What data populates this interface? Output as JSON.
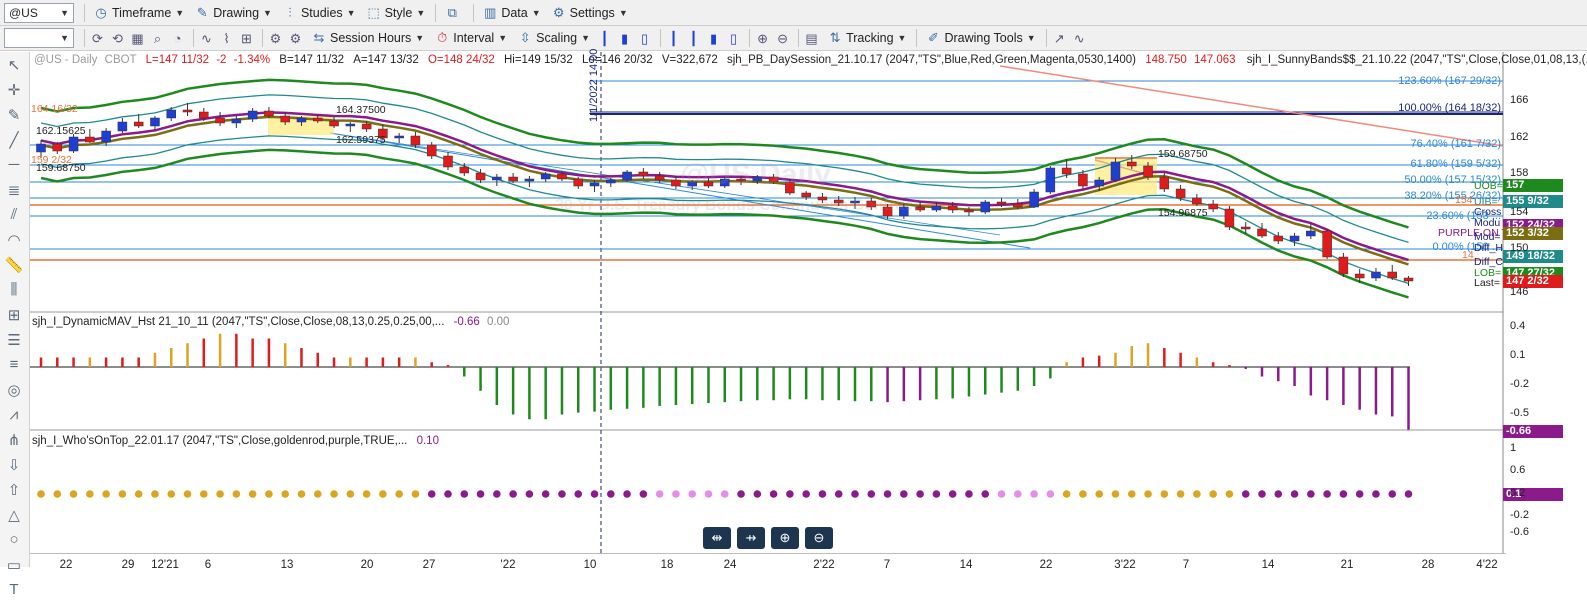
{
  "toolbar1": {
    "symbol": "@US",
    "timeframe": "Timeframe",
    "drawing": "Drawing",
    "studies": "Studies",
    "style": "Style",
    "data": "Data",
    "settings": "Settings"
  },
  "toolbar2": {
    "session_hours": "Session Hours",
    "interval": "Interval",
    "scaling": "Scaling",
    "tracking": "Tracking",
    "drawing_tools": "Drawing Tools"
  },
  "chart_header": {
    "symbol": "@US - Daily",
    "exchange": "CBOT",
    "last": "L=147 11/32",
    "chg": "-2",
    "chg_pct": "-1.34%",
    "bid": "B=147 11/32",
    "ask": "A=147 13/32",
    "open": "O=148 24/32",
    "high": "Hi=149 15/32",
    "low": "Lo=146 20/32",
    "volume": "V=322,672",
    "study1": "sjh_PB_DaySession_21.10.17 (2047,\"TS\",Blue,Red,Green,Magenta,0530,1400)",
    "study1_v1": "148.750",
    "study1_v2": "147.063",
    "study2": "sjh_I_SunnyBands$$_21.10.22 (2047,\"TS\",Close,Close,01,08,13,(..."
  },
  "watermark": {
    "title": "@US Daily",
    "subtitle": "30 Yr U.S. Treasury Bonds Continuous Contract"
  },
  "vline_label": "1/1/2022 14:00",
  "price_labels": {
    "a1": "164.37500",
    "a2": "162.59375",
    "a3": "162.15625",
    "a4": "159.68750",
    "a5": "164 16/32",
    "a6": "159 2/32",
    "b1": "159.68750",
    "b2": "154.96875",
    "purple": "PURPLE ON TOP"
  },
  "fib_levels": [
    {
      "label": "123.60% (167 29/32)"
    },
    {
      "label": "100.00% (164 18/32)"
    },
    {
      "label": "76.40% (161 7/32)"
    },
    {
      "label": "61.80% (159 5/32)"
    },
    {
      "label": "50.00% (157 15/32)"
    },
    {
      "label": "38.20% (155 26/32)"
    },
    {
      "label": "23.60% (153 ..."
    },
    {
      "label": "0.00% (150 ..."
    }
  ],
  "right_tags": {
    "uob": "UOB=",
    "uib": "UIB=",
    "cross": "Cross",
    "modu": "Modu",
    "modl": "Mod=",
    "diffh": "Diff_H",
    "diffc": "Diff_C",
    "lob": "LOB=",
    "last": "Last=",
    "t154": "154",
    "t14": "14"
  },
  "price_axis": [
    "166",
    "162",
    "158",
    "154",
    "150",
    "146"
  ],
  "price_boxes": [
    {
      "text": "157",
      "color": "#1e8a1e"
    },
    {
      "text": "155 9/32",
      "color": "#1f8a8a"
    },
    {
      "text": "152 24/32",
      "color": "#8b1a8b"
    },
    {
      "text": "152 3/32",
      "color": "#7a6e10"
    },
    {
      "text": "149 18/32",
      "color": "#1f8a8a"
    },
    {
      "text": "147 27/32",
      "color": "#1e8a1e"
    },
    {
      "text": "147 2/32",
      "color": "#e01b1b"
    }
  ],
  "panel2": {
    "title": "sjh_I_DynamicMAV_Hst 21_10_11 (2047,\"TS\",Close,Close,08,13,0.25,0.25,00,...",
    "v1": "-0.66",
    "v2": "0.00",
    "axis": [
      "0.4",
      "0.1",
      "-0.2",
      "-0.5"
    ],
    "box": "-0.66"
  },
  "panel3": {
    "title": "sjh_I_Who'sOnTop_22.01.17 (2047,\"TS\",Close,goldenrod,purple,TRUE,...",
    "v1": "0.10",
    "axis": [
      "1",
      "0.6",
      "0.2",
      "-0.2",
      "-0.6"
    ],
    "box": "0.1"
  },
  "x_axis": [
    "22",
    "29",
    "12'21",
    "6",
    "13",
    "20",
    "27",
    "'22",
    "10",
    "18",
    "24",
    "2'22",
    "7",
    "14",
    "22",
    "3'22",
    "7",
    "14",
    "21",
    "28",
    "4'22"
  ],
  "left_tools": [
    "cursor-icon",
    "crosshair-icon",
    "pencil-icon",
    "trendline-icon",
    "horizontal-line-icon",
    "fibonacci-icon",
    "channel-icon",
    "arc-icon",
    "ruler-icon",
    "bars-icon",
    "grid-icon",
    "layers-icon",
    "lines-icon",
    "gann-icon",
    "pattern-icon",
    "pitchfork-icon",
    "down-arrow-icon",
    "up-arrow-icon",
    "triangle-icon",
    "circle-icon",
    "rectangle-icon",
    "text-icon"
  ],
  "colors": {
    "up": "#1f3fd0",
    "down": "#e01b1b",
    "bandgreen": "#1e8a1e",
    "teal": "#1f8a8a",
    "olive": "#7a6e10",
    "purple": "#8b1a8b",
    "goldenrod": "#daa520",
    "fib": "#2d87d8"
  },
  "chart_data": {
    "type": "candlestick",
    "candles": [
      [
        160.0,
        161.2,
        159.4,
        160.8
      ],
      [
        160.8,
        161.0,
        159.8,
        160.1
      ],
      [
        160.1,
        161.8,
        159.9,
        161.5
      ],
      [
        161.5,
        162.3,
        160.9,
        161.0
      ],
      [
        161.0,
        162.4,
        160.6,
        162.1
      ],
      [
        162.1,
        163.4,
        161.9,
        163.0
      ],
      [
        163.0,
        163.8,
        162.4,
        162.6
      ],
      [
        162.6,
        163.6,
        162.2,
        163.4
      ],
      [
        163.4,
        164.5,
        163.1,
        164.2
      ],
      [
        164.2,
        164.9,
        163.6,
        164.0
      ],
      [
        164.0,
        164.4,
        163.1,
        163.4
      ],
      [
        163.4,
        164.0,
        162.6,
        162.9
      ],
      [
        162.9,
        163.6,
        162.4,
        163.3
      ],
      [
        163.3,
        164.4,
        163.0,
        164.1
      ],
      [
        164.1,
        164.5,
        163.4,
        163.6
      ],
      [
        163.6,
        164.0,
        162.7,
        163.0
      ],
      [
        163.0,
        163.6,
        162.6,
        163.4
      ],
      [
        163.4,
        163.8,
        162.9,
        163.1
      ],
      [
        163.1,
        163.5,
        162.4,
        162.6
      ],
      [
        162.6,
        163.0,
        162.0,
        162.8
      ],
      [
        162.8,
        163.1,
        162.0,
        162.3
      ],
      [
        162.3,
        162.8,
        161.2,
        161.4
      ],
      [
        161.4,
        161.9,
        160.9,
        161.6
      ],
      [
        161.6,
        162.0,
        160.4,
        160.7
      ],
      [
        160.7,
        161.0,
        159.3,
        159.6
      ],
      [
        159.6,
        160.0,
        158.2,
        158.5
      ],
      [
        158.5,
        158.9,
        157.6,
        157.9
      ],
      [
        157.9,
        158.3,
        156.9,
        157.2
      ],
      [
        157.2,
        157.8,
        156.6,
        157.5
      ],
      [
        157.5,
        157.9,
        156.9,
        157.1
      ],
      [
        157.1,
        157.6,
        156.5,
        157.3
      ],
      [
        157.3,
        158.0,
        157.0,
        157.8
      ],
      [
        157.8,
        158.1,
        157.1,
        157.3
      ],
      [
        157.3,
        157.5,
        156.3,
        156.6
      ],
      [
        156.6,
        157.2,
        156.0,
        156.9
      ],
      [
        156.9,
        157.4,
        156.5,
        157.2
      ],
      [
        157.2,
        158.2,
        157.0,
        158.0
      ],
      [
        158.0,
        158.4,
        157.3,
        157.6
      ],
      [
        157.6,
        158.0,
        156.9,
        157.2
      ],
      [
        157.2,
        157.6,
        156.3,
        156.6
      ],
      [
        156.6,
        157.2,
        156.2,
        157.0
      ],
      [
        157.0,
        157.4,
        156.4,
        156.6
      ],
      [
        156.6,
        157.5,
        156.4,
        157.3
      ],
      [
        157.3,
        157.6,
        156.7,
        157.1
      ],
      [
        157.1,
        157.7,
        156.8,
        157.5
      ],
      [
        157.5,
        157.8,
        156.8,
        157.0
      ],
      [
        157.0,
        157.3,
        155.7,
        155.9
      ],
      [
        155.9,
        156.1,
        155.2,
        155.5
      ],
      [
        155.5,
        155.9,
        154.9,
        155.2
      ],
      [
        155.2,
        155.6,
        154.6,
        154.9
      ],
      [
        154.9,
        155.5,
        154.3,
        155.1
      ],
      [
        155.1,
        155.4,
        154.2,
        154.5
      ],
      [
        154.5,
        154.8,
        153.3,
        153.6
      ],
      [
        153.6,
        154.8,
        153.3,
        154.5
      ],
      [
        154.5,
        155.1,
        154.0,
        154.2
      ],
      [
        154.2,
        155.0,
        154.0,
        154.6
      ],
      [
        154.6,
        155.0,
        153.9,
        154.2
      ],
      [
        154.2,
        154.5,
        153.6,
        154.0
      ],
      [
        154.0,
        155.2,
        153.8,
        155.0
      ],
      [
        155.0,
        155.4,
        154.5,
        154.8
      ],
      [
        154.8,
        155.3,
        154.3,
        154.5
      ],
      [
        154.5,
        156.3,
        154.4,
        156.0
      ],
      [
        156.0,
        158.6,
        155.8,
        158.4
      ],
      [
        158.4,
        159.3,
        157.4,
        157.8
      ],
      [
        157.8,
        158.2,
        156.3,
        156.6
      ],
      [
        156.6,
        157.5,
        156.1,
        157.2
      ],
      [
        157.2,
        159.4,
        157.0,
        159.0
      ],
      [
        159.0,
        159.7,
        158.3,
        158.6
      ],
      [
        158.6,
        159.0,
        157.2,
        157.5
      ],
      [
        157.5,
        157.9,
        156.0,
        156.3
      ],
      [
        156.3,
        156.7,
        155.1,
        155.4
      ],
      [
        155.4,
        155.8,
        154.6,
        154.8
      ],
      [
        154.8,
        155.2,
        154.0,
        154.3
      ],
      [
        154.3,
        154.6,
        152.2,
        152.5
      ],
      [
        152.5,
        153.0,
        151.8,
        152.3
      ],
      [
        152.3,
        152.9,
        151.4,
        151.6
      ],
      [
        151.6,
        152.0,
        150.8,
        151.1
      ],
      [
        151.1,
        151.9,
        150.6,
        151.6
      ],
      [
        151.6,
        152.8,
        151.3,
        152.1
      ],
      [
        152.1,
        152.3,
        149.3,
        149.5
      ],
      [
        149.5,
        149.9,
        147.5,
        147.8
      ],
      [
        147.8,
        148.3,
        146.9,
        147.4
      ],
      [
        147.4,
        148.4,
        147.1,
        148.0
      ],
      [
        148.0,
        148.7,
        147.2,
        147.4
      ],
      [
        147.4,
        147.6,
        146.6,
        147.1
      ]
    ],
    "hist": [
      0.1,
      0.1,
      0.1,
      0.1,
      0.1,
      0.1,
      0.1,
      0.15,
      0.2,
      0.25,
      0.3,
      0.35,
      0.35,
      0.3,
      0.3,
      0.25,
      0.2,
      0.15,
      0.1,
      0.1,
      0.1,
      0.1,
      0.1,
      0.1,
      0.05,
      0.02,
      -0.1,
      -0.25,
      -0.4,
      -0.5,
      -0.55,
      -0.55,
      -0.5,
      -0.48,
      -0.47,
      -0.45,
      -0.44,
      -0.43,
      -0.41,
      -0.4,
      -0.39,
      -0.38,
      -0.37,
      -0.36,
      -0.35,
      -0.35,
      -0.34,
      -0.34,
      -0.35,
      -0.35,
      -0.36,
      -0.36,
      -0.37,
      -0.36,
      -0.35,
      -0.34,
      -0.33,
      -0.31,
      -0.29,
      -0.27,
      -0.25,
      -0.2,
      -0.12,
      0.05,
      0.1,
      0.12,
      0.15,
      0.22,
      0.25,
      0.2,
      0.15,
      0.1,
      0.05,
      0.02,
      -0.02,
      -0.1,
      -0.15,
      -0.2,
      -0.3,
      -0.35,
      -0.4,
      -0.45,
      -0.5,
      -0.52,
      -0.66
    ],
    "who": [
      0,
      0,
      0,
      0,
      0,
      0,
      0,
      0,
      0,
      0,
      0,
      0,
      0,
      0,
      0,
      0,
      0,
      0,
      0,
      0,
      0,
      0,
      0,
      0,
      1,
      1,
      1,
      1,
      1,
      1,
      1,
      1,
      1,
      1,
      1,
      1,
      1,
      1,
      2,
      2,
      2,
      2,
      2,
      1,
      1,
      1,
      1,
      1,
      1,
      1,
      1,
      1,
      1,
      1,
      1,
      1,
      1,
      1,
      1,
      2,
      2,
      2,
      2,
      0,
      0,
      0,
      0,
      0,
      0,
      0,
      0,
      0,
      0,
      0,
      1,
      1,
      1,
      1,
      1,
      1,
      1,
      1,
      1,
      1,
      1
    ]
  }
}
